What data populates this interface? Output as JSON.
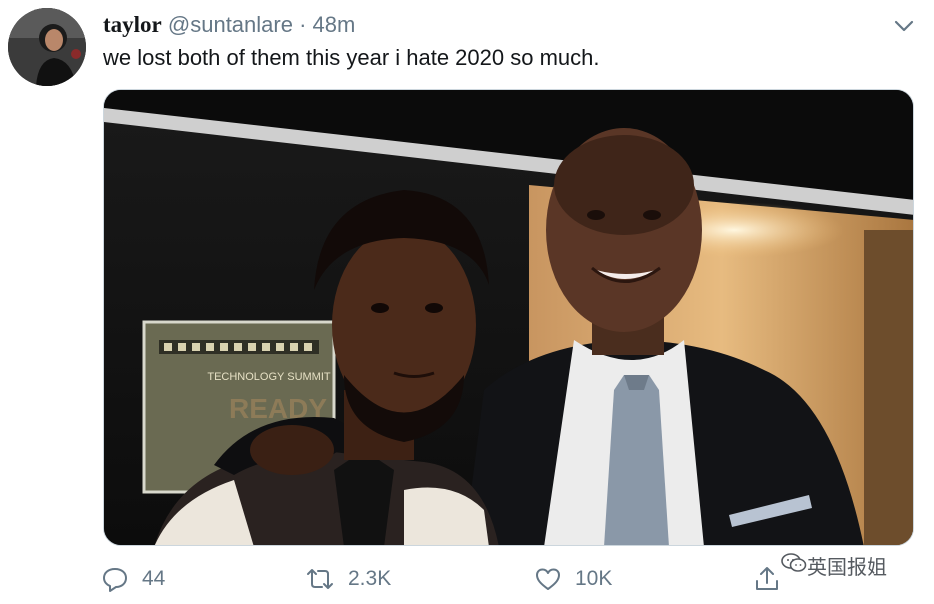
{
  "tweet": {
    "display_name": "taylor",
    "handle": "@suntanlare",
    "separator": "·",
    "timestamp": "48m",
    "text": "we lost both of them this year i hate 2020 so much.",
    "menu_icon": "chevron-down-icon"
  },
  "media": {
    "poster_line1": "TECHNOLOGY SUMMIT",
    "poster_big": "READY"
  },
  "actions": {
    "reply_count": "44",
    "retweet_count": "2.3K",
    "like_count": "10K",
    "reply_icon": "reply-icon",
    "retweet_icon": "retweet-icon",
    "like_icon": "heart-icon",
    "share_icon": "share-icon"
  },
  "watermark": {
    "text": "英国报姐"
  },
  "colors": {
    "text": "#14171a",
    "secondary": "#657786",
    "border": "#ccd6dd"
  }
}
